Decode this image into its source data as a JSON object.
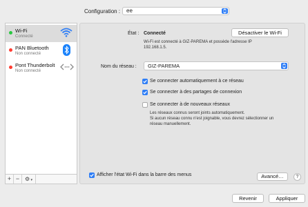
{
  "config": {
    "label": "Configuration :",
    "value": "ee"
  },
  "services": [
    {
      "name": "Wi-Fi",
      "status": "Connecté",
      "dot_color": "#28c840",
      "icon": "wifi-icon"
    },
    {
      "name": "PAN Bluetooth",
      "status": "Non connecté",
      "dot_color": "#ff3b30",
      "icon": "bluetooth-icon"
    },
    {
      "name": "Pont Thunderbolt",
      "status": "Non connecté",
      "dot_color": "#ff3b30",
      "icon": "thunderbolt-bridge-icon"
    }
  ],
  "toolbar": {
    "add": "+",
    "remove": "−",
    "gear": "⚙"
  },
  "status": {
    "label": "État :",
    "value": "Connecté",
    "button": "Désactiver le Wi-Fi",
    "desc_line1": "Wi-Fi est connecté à GIZ-PAREMA et possède l'adresse IP",
    "desc_line2": "192.168.1.5."
  },
  "network": {
    "label": "Nom du réseau :",
    "value": "GIZ-PAREMA"
  },
  "options": [
    {
      "label": "Se connecter automatiquement à ce réseau",
      "checked": true
    },
    {
      "label": "Se connecter à des partages de connexion",
      "checked": true
    },
    {
      "label": "Se connecter à de nouveaux réseaux",
      "checked": false
    }
  ],
  "info": {
    "line1": "Les réseaux connus seront joints automatiquement.",
    "line2": "Si aucun réseau connu n'est joignable, vous devrez sélectionner un",
    "line3": "réseau manuellement."
  },
  "footer": {
    "show_wifi": "Afficher l'état Wi-Fi dans la barre des menus",
    "show_wifi_checked": true,
    "advanced": "Avancé…",
    "help": "?"
  },
  "actions": {
    "revert": "Revenir",
    "apply": "Appliquer"
  },
  "colors": {
    "accent": "#2f7ef6",
    "connected": "#28c840",
    "disconnected": "#ff3b30"
  }
}
